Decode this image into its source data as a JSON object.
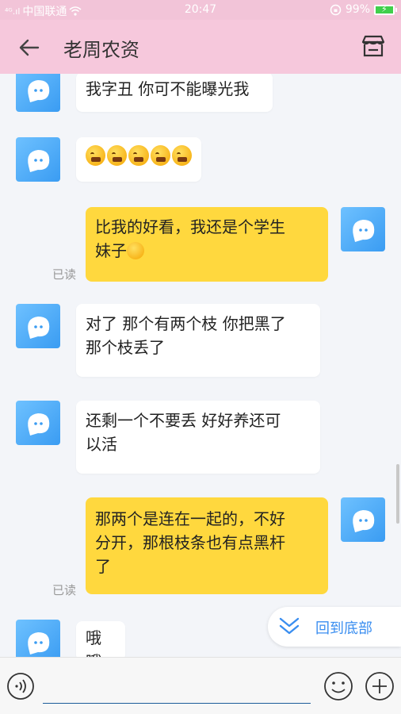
{
  "status_bar": {
    "signal": "⁴ᴳ.ıl",
    "carrier": "中国联通",
    "time": "20:47",
    "battery": "99%"
  },
  "header": {
    "title": "老周农资"
  },
  "messages": [
    {
      "side": "left",
      "text": "我字丑 你可不能曝光我"
    },
    {
      "side": "left",
      "type": "emoji-row",
      "count": 5
    },
    {
      "side": "right",
      "line1": "比我的好看，我还是个学生",
      "line2": "妹子",
      "read": "已读"
    },
    {
      "side": "left",
      "line1": "对了 那个有两个枝 你把黑了",
      "line2": "那个枝丢了"
    },
    {
      "side": "left",
      "line1": "还剩一个不要丢 好好养还可",
      "line2": "以活"
    },
    {
      "side": "right",
      "line1": "那两个是连在一起的，不好",
      "line2": "分开，那根枝条也有点黑杆",
      "line3": "了",
      "read": "已读"
    },
    {
      "side": "left",
      "text": "哦哦"
    }
  ],
  "back_to_bottom": {
    "label": "回到底部"
  },
  "colors": {
    "header_bg": "#f6c8dc",
    "bubble_right": "#ffd83e",
    "bubble_left": "#ffffff",
    "avatar": "#3a9cf2",
    "accent_blue": "#3a8ef0"
  }
}
